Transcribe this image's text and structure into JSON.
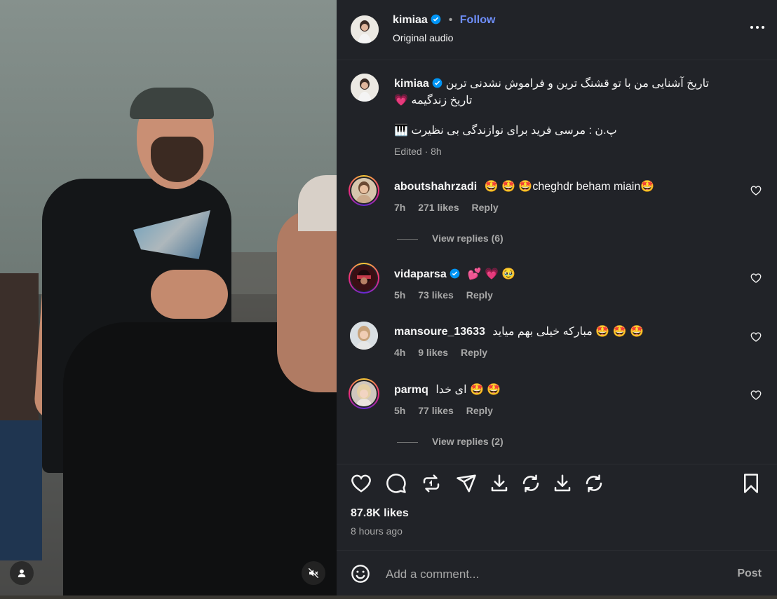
{
  "post": {
    "username": "kimiaa",
    "follow_label": "Follow",
    "dot": "•",
    "audio": "Original audio",
    "more_label": "..."
  },
  "caption": {
    "username": "kimiaa",
    "line1": "تاریخ آشنایی من با تو قشنگ ترین و فراموش نشدنی ترین",
    "line2": "تاریخ زندگیمه 💗",
    "line3": "پ.ن : مرسی فرید برای نوازندگی بی نظیرت 🎹",
    "edited": "Edited · 8h"
  },
  "comments": [
    {
      "username": "aboutshahrzadi",
      "text": "🤩 🤩 🤩cheghdr beham miain🤩",
      "time": "7h",
      "likes": "271 likes",
      "reply": "Reply",
      "verified": false
    },
    {
      "username": "vidaparsa",
      "text": "💕 💗 🥹",
      "time": "5h",
      "likes": "73 likes",
      "reply": "Reply",
      "verified": true
    },
    {
      "username": "mansoure_13633",
      "text": "🤩 🤩 🤩 مبارکه خیلی بهم میاید",
      "time": "4h",
      "likes": "9 likes",
      "reply": "Reply",
      "verified": false
    },
    {
      "username": "parmq",
      "text": "🤩 🤩 ای خدا",
      "time": "5h",
      "likes": "77 likes",
      "reply": "Reply",
      "verified": false
    }
  ],
  "view_replies": [
    "View replies (6)",
    "View replies (2)"
  ],
  "likes_count": "87.8K likes",
  "posted_ago": "8 hours ago",
  "comment_box": {
    "placeholder": "Add a comment...",
    "post_label": "Post"
  },
  "colors": {
    "panel": "#212328",
    "follow": "#0095f6",
    "verified": "#0095f6",
    "muted": "#a8a8a8"
  },
  "icons": [
    "heart-icon",
    "comment-icon",
    "repost-icon",
    "share-icon",
    "download-icon",
    "refresh-icon",
    "download-icon",
    "refresh-icon",
    "bookmark-icon",
    "emoji-icon",
    "mute-icon",
    "person-icon"
  ]
}
